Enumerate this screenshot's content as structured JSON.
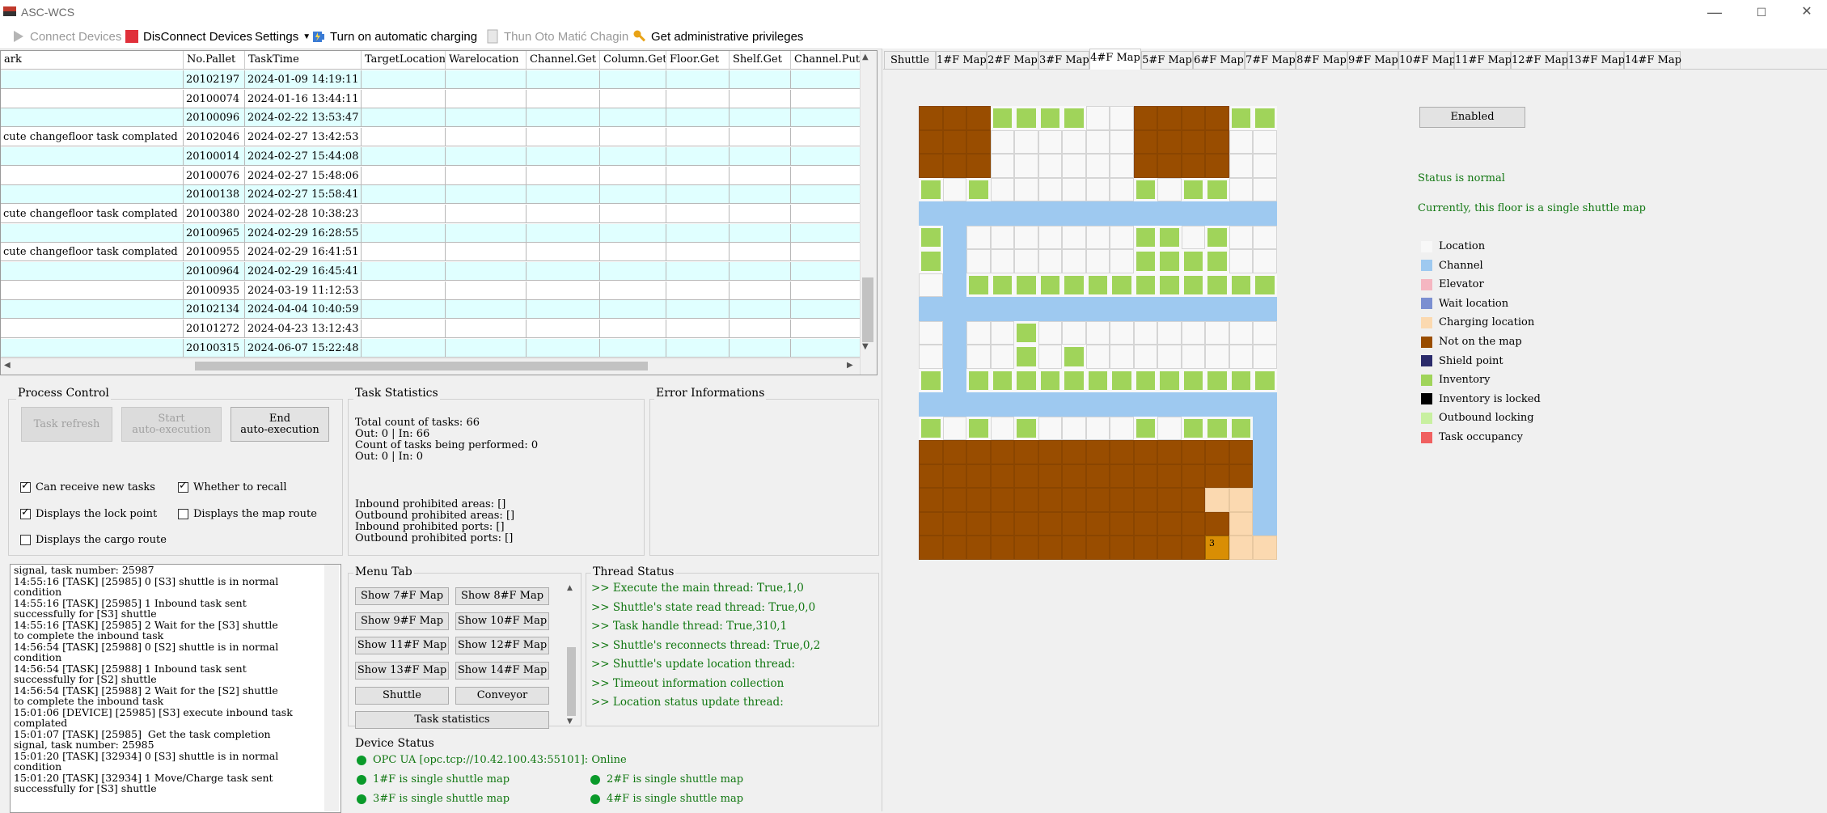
{
  "window": {
    "title": "ASC-WCS",
    "minimize": "—",
    "maximize": "☐",
    "close": "✕"
  },
  "toolbar": {
    "connect": "Connect Devices",
    "disconnect": "DisConnect Devices",
    "settings": "Settings",
    "auto_charge": "Turn on automatic charging",
    "thun": "Thun Oto Matić Chagin",
    "admin": "Get administrative privileges"
  },
  "grid": {
    "columns": [
      "ark",
      "No.Pallet",
      "TaskTime",
      "TargetLocation",
      "Warelocation",
      "Channel.Get",
      "Column.Get",
      "Floor.Get",
      "Shelf.Get",
      "Channel.Put"
    ],
    "rows": [
      [
        "",
        "20102197",
        "2024-01-09 14:19:11"
      ],
      [
        "",
        "20100074",
        "2024-01-16 13:44:11"
      ],
      [
        "",
        "20100096",
        "2024-02-22 13:53:47"
      ],
      [
        "cute changefloor task complated",
        "20102046",
        "2024-02-27 13:42:53"
      ],
      [
        "",
        "20100014",
        "2024-02-27 15:44:08"
      ],
      [
        "",
        "20100076",
        "2024-02-27 15:48:06"
      ],
      [
        "",
        "20100138",
        "2024-02-27 15:58:41"
      ],
      [
        "cute changefloor task complated",
        "20100380",
        "2024-02-28 10:38:23"
      ],
      [
        "",
        "20100965",
        "2024-02-29 16:28:55"
      ],
      [
        "cute changefloor task complated",
        "20100955",
        "2024-02-29 16:41:51"
      ],
      [
        "",
        "20100964",
        "2024-02-29 16:45:41"
      ],
      [
        "",
        "20100935",
        "2024-03-19 11:12:53"
      ],
      [
        "",
        "20102134",
        "2024-04-04 10:40:59"
      ],
      [
        "",
        "20101272",
        "2024-04-23 13:12:43"
      ],
      [
        "",
        "20100315",
        "2024-06-07 15:22:48"
      ]
    ]
  },
  "process": {
    "title": "Process Control",
    "task_refresh": "Task refresh",
    "start_auto": [
      "Start",
      "auto-execution"
    ],
    "end_auto": [
      "End",
      "auto-execution"
    ],
    "checks": [
      {
        "label": "Can receive new tasks",
        "checked": true
      },
      {
        "label": "Whether to recall",
        "checked": true
      },
      {
        "label": "Displays the lock point",
        "checked": true
      },
      {
        "label": "Displays the map route",
        "checked": false
      },
      {
        "label": "Displays the cargo route",
        "checked": false
      }
    ]
  },
  "stats": {
    "title": "Task Statistics",
    "lines": [
      "Total count of tasks: 66",
      "Out: 0 | In: 66",
      "Count of tasks being performed: 0",
      "Out: 0 | In: 0"
    ],
    "prohibited": [
      "Inbound prohibited areas: []",
      "Outbound prohibited areas: []",
      "Inbound prohibited ports: []",
      "Outbound prohibited ports: []"
    ]
  },
  "errors": {
    "title": "Error Informations"
  },
  "log": [
    "signal, task number: 25987",
    "14:55:16 [TASK] [25985] 0 [S3] shuttle is in normal",
    "condition",
    "14:55:16 [TASK] [25985] 1 Inbound task sent",
    "successfully for [S3] shuttle",
    "14:55:16 [TASK] [25985] 2 Wait for the [S3] shuttle",
    "to complete the inbound task",
    "14:56:54 [TASK] [25988] 0 [S2] shuttle is in normal",
    "condition",
    "14:56:54 [TASK] [25988] 1 Inbound task sent",
    "successfully for [S2] shuttle",
    "14:56:54 [TASK] [25988] 2 Wait for the [S2] shuttle",
    "to complete the inbound task",
    "15:01:06 [DEVICE] [25985] [S3] execute inbound task",
    "complated",
    "15:01:07 [TASK] [25985]  Get the task completion",
    "signal, task number: 25985",
    "15:01:20 [TASK] [32934] 0 [S3] shuttle is in normal",
    "condition",
    "15:01:20 [TASK] [32934] 1 Move/Charge task sent",
    "successfully for [S3] shuttle"
  ],
  "menu": {
    "title": "Menu Tab",
    "buttons": [
      "Show 7#F Map",
      "Show 8#F Map",
      "Show 9#F Map",
      "Show 10#F Map",
      "Show 11#F Map",
      "Show 12#F Map",
      "Show 13#F Map",
      "Show 14#F Map",
      "Shuttle",
      "Conveyor"
    ],
    "task_stats": "Task statistics"
  },
  "threads": {
    "title": "Thread Status",
    "lines": [
      ">> Execute the main thread: True,1,0",
      ">> Shuttle's state read thread: True,0,0",
      ">> Task handle thread: True,310,1",
      ">> Shuttle's reconnects thread: True,0,2",
      ">> Shuttle's update location thread:",
      ">> Timeout information collection",
      ">> Location status update thread:"
    ]
  },
  "device": {
    "title": "Device Status",
    "opc": "OPC UA [opc.tcp://10.42.100.43:55101]: Online",
    "floors": [
      "1#F is single shuttle map",
      "2#F is single shuttle map",
      "3#F is single shuttle map",
      "4#F is single shuttle map"
    ]
  },
  "tabs": [
    "Shuttle",
    "1#F Map",
    "2#F Map",
    "3#F Map",
    "4#F Map",
    "5#F Map",
    "6#F Map",
    "7#F Map",
    "8#F Map",
    "9#F Map",
    "10#F Map",
    "11#F Map",
    "12#F Map",
    "13#F Map",
    "14#F Map"
  ],
  "active_tab": "4#F Map",
  "map_panel": {
    "enabled": "Enabled",
    "status": "Status is normal",
    "mode": "Currently, this floor is a single shuttle map",
    "shuttle_label": "3"
  },
  "legend": [
    {
      "label": "Location",
      "color": "#f8f8f8"
    },
    {
      "label": "Channel",
      "color": "#9ec9f0"
    },
    {
      "label": "Elevator",
      "color": "#f5b6c1"
    },
    {
      "label": "Wait location",
      "color": "#7b8fd1"
    },
    {
      "label": "Charging location",
      "color": "#fbd9b0"
    },
    {
      "label": "Not on the map",
      "color": "#994d00"
    },
    {
      "label": "Shield point",
      "color": "#2b2b6b"
    },
    {
      "label": "Inventory",
      "color": "#a0d45a"
    },
    {
      "label": "Inventory is locked",
      "color": "#000000"
    },
    {
      "label": "Outbound locking",
      "color": "#c8f0a0"
    },
    {
      "label": "Task occupancy",
      "color": "#f06060"
    }
  ],
  "map_grid": [
    "BBBGGGGWWBBBBGG",
    "BBBWWWWWWBBBBWW",
    "BBBWWWWWWBBBBWW",
    "GWGWWWWWWGWGGWW",
    "CCCCCCCCCCCCCCC",
    "GCWWWWWWWGGWGWW",
    "GCWWWWWWWGGGGWW",
    "WCGGGGGGGGGGGGG",
    "CCCCCCCCCCCCCCC",
    "WCWWGWWWWWWWWWW",
    "WCWWGWGWWWWWWWW",
    "GCGGGGGGGGGGGGG",
    "CCCCCCCCCCCCCCC",
    "GWGWGWWWWGWGGGC",
    "BBBBBBBBBBBBBBC",
    "BBBBBBBBBBBBBBC",
    "BBBBBBBBBBBBPPC",
    "BBBBBBBBBBBBBPC",
    "BBBBBBBBBBBBSPP"
  ],
  "colors": {
    "W": "#f8f8f8",
    "C": "#9ec9f0",
    "B": "#994d00",
    "G": "#a0d45a",
    "P": "#fbd9b0",
    "S": "#d98e04"
  }
}
